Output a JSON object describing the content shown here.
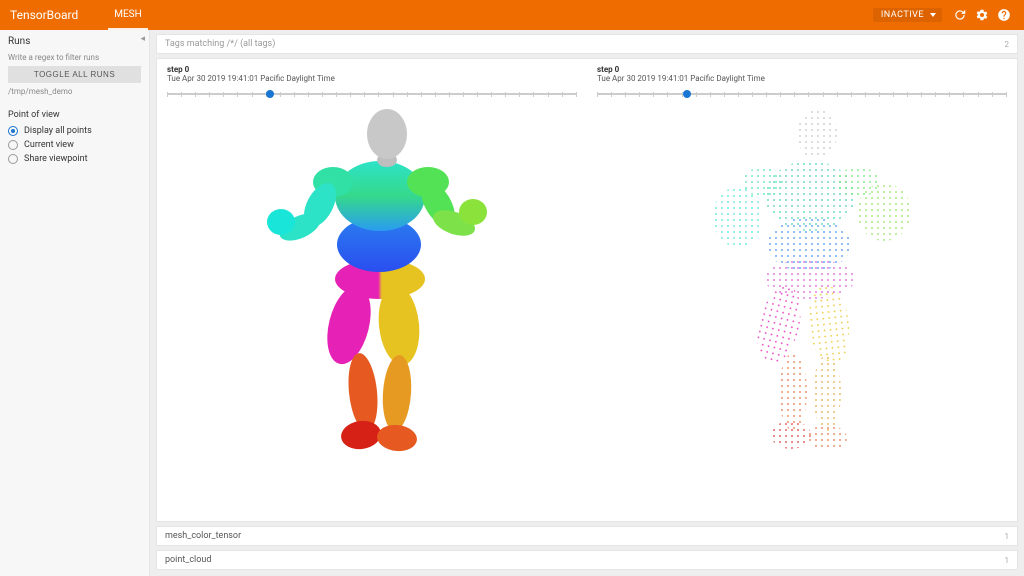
{
  "header": {
    "app_title": "TensorBoard",
    "active_tab": "MESH",
    "status_chip": "INACTIVE"
  },
  "sidebar": {
    "runs_title": "Runs",
    "filter_placeholder": "Write a regex to filter runs",
    "toggle_all_label": "TOGGLE ALL RUNS",
    "run_path": "/tmp/mesh_demo",
    "pov_title": "Point of view",
    "pov_options": [
      {
        "label": "Display all points",
        "selected": true
      },
      {
        "label": "Current view",
        "selected": false
      },
      {
        "label": "Share viewpoint",
        "selected": false
      }
    ]
  },
  "main": {
    "tag_filter_text": "Tags matching /*/ (all tags)",
    "tag_filter_count": "2",
    "panes": [
      {
        "step_label": "step 0",
        "timestamp": "Tue Apr 30 2019 19:41:01 Pacific Daylight Time",
        "slider_pos_pct": 25
      },
      {
        "step_label": "step 0",
        "timestamp": "Tue Apr 30 2019 19:41:01 Pacific Daylight Time",
        "slider_pos_pct": 22
      }
    ],
    "accordions": [
      {
        "label": "mesh_color_tensor",
        "count": "1"
      },
      {
        "label": "point_cloud",
        "count": "1"
      }
    ]
  }
}
